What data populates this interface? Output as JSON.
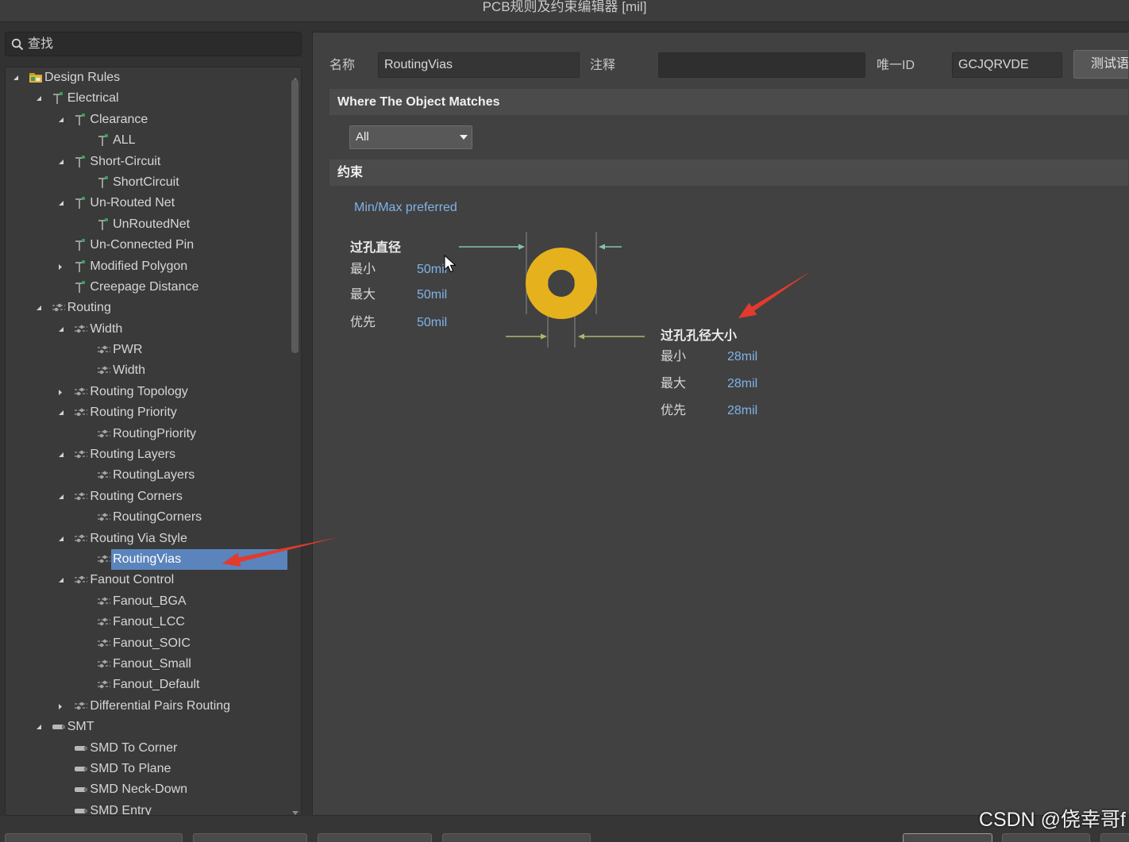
{
  "window": {
    "title": "PCB规则及约束编辑器 [mil]"
  },
  "search": {
    "placeholder": "查找"
  },
  "tree": [
    {
      "label": "Design Rules",
      "icon": "design-rules-folder-icon",
      "expanded": true,
      "children": [
        {
          "label": "Electrical",
          "icon": "electrical-rule-icon",
          "expanded": true,
          "children": [
            {
              "label": "Clearance",
              "icon": "electrical-rule-icon",
              "expanded": true,
              "children": [
                {
                  "label": "ALL",
                  "icon": "electrical-rule-icon"
                }
              ]
            },
            {
              "label": "Short-Circuit",
              "icon": "electrical-rule-icon",
              "expanded": true,
              "children": [
                {
                  "label": "ShortCircuit",
                  "icon": "electrical-rule-icon"
                }
              ]
            },
            {
              "label": "Un-Routed Net",
              "icon": "electrical-rule-icon",
              "expanded": true,
              "children": [
                {
                  "label": "UnRoutedNet",
                  "icon": "electrical-rule-icon"
                }
              ]
            },
            {
              "label": "Un-Connected Pin",
              "icon": "electrical-rule-icon"
            },
            {
              "label": "Modified Polygon",
              "icon": "electrical-rule-icon",
              "expanded": false
            },
            {
              "label": "Creepage Distance",
              "icon": "electrical-rule-icon"
            }
          ]
        },
        {
          "label": "Routing",
          "icon": "routing-rule-icon",
          "expanded": true,
          "children": [
            {
              "label": "Width",
              "icon": "routing-rule-icon",
              "expanded": true,
              "children": [
                {
                  "label": "PWR",
                  "icon": "routing-rule-icon"
                },
                {
                  "label": "Width",
                  "icon": "routing-rule-icon"
                }
              ]
            },
            {
              "label": "Routing Topology",
              "icon": "routing-rule-icon",
              "expanded": false
            },
            {
              "label": "Routing Priority",
              "icon": "routing-rule-icon",
              "expanded": true,
              "children": [
                {
                  "label": "RoutingPriority",
                  "icon": "routing-rule-icon"
                }
              ]
            },
            {
              "label": "Routing Layers",
              "icon": "routing-rule-icon",
              "expanded": true,
              "children": [
                {
                  "label": "RoutingLayers",
                  "icon": "routing-rule-icon"
                }
              ]
            },
            {
              "label": "Routing Corners",
              "icon": "routing-rule-icon",
              "expanded": true,
              "children": [
                {
                  "label": "RoutingCorners",
                  "icon": "routing-rule-icon"
                }
              ]
            },
            {
              "label": "Routing Via Style",
              "icon": "routing-rule-icon",
              "expanded": true,
              "children": [
                {
                  "label": "RoutingVias",
                  "icon": "routing-rule-icon",
                  "selected": true
                }
              ]
            },
            {
              "label": "Fanout Control",
              "icon": "routing-rule-icon",
              "expanded": true,
              "children": [
                {
                  "label": "Fanout_BGA",
                  "icon": "routing-rule-icon"
                },
                {
                  "label": "Fanout_LCC",
                  "icon": "routing-rule-icon"
                },
                {
                  "label": "Fanout_SOIC",
                  "icon": "routing-rule-icon"
                },
                {
                  "label": "Fanout_Small",
                  "icon": "routing-rule-icon"
                },
                {
                  "label": "Fanout_Default",
                  "icon": "routing-rule-icon"
                }
              ]
            },
            {
              "label": "Differential Pairs Routing",
              "icon": "routing-rule-icon",
              "expanded": false
            }
          ]
        },
        {
          "label": "SMT",
          "icon": "smt-rule-icon",
          "expanded": true,
          "children": [
            {
              "label": "SMD To Corner",
              "icon": "smt-rule-icon"
            },
            {
              "label": "SMD To Plane",
              "icon": "smt-rule-icon"
            },
            {
              "label": "SMD Neck-Down",
              "icon": "smt-rule-icon"
            },
            {
              "label": "SMD Entry",
              "icon": "smt-rule-icon"
            }
          ]
        }
      ]
    }
  ],
  "form": {
    "name_label": "名称",
    "name_value": "RoutingVias",
    "comment_label": "注释",
    "comment_value": "",
    "id_label": "唯一ID",
    "id_value": "GCJQRVDE",
    "test_button": "测试语"
  },
  "scope": {
    "header": "Where The Object Matches",
    "selected": "All"
  },
  "constraints": {
    "header": "约束",
    "mode": "Min/Max preferred",
    "via_diameter": {
      "title": "过孔直径",
      "rows": [
        {
          "label": "最小",
          "value": "50mil"
        },
        {
          "label": "最大",
          "value": "50mil"
        },
        {
          "label": "优先",
          "value": "50mil"
        }
      ]
    },
    "hole_size": {
      "title": "过孔孔径大小",
      "rows": [
        {
          "label": "最小",
          "value": "28mil"
        },
        {
          "label": "最大",
          "value": "28mil"
        },
        {
          "label": "优先",
          "value": "28mil"
        }
      ]
    }
  },
  "watermark": "CSDN @侥幸哥f",
  "colors": {
    "selection": "#5a84bb",
    "value_text": "#7fb3e8",
    "via_ring": "#e5b21e",
    "annotation": "#e33a2e"
  }
}
